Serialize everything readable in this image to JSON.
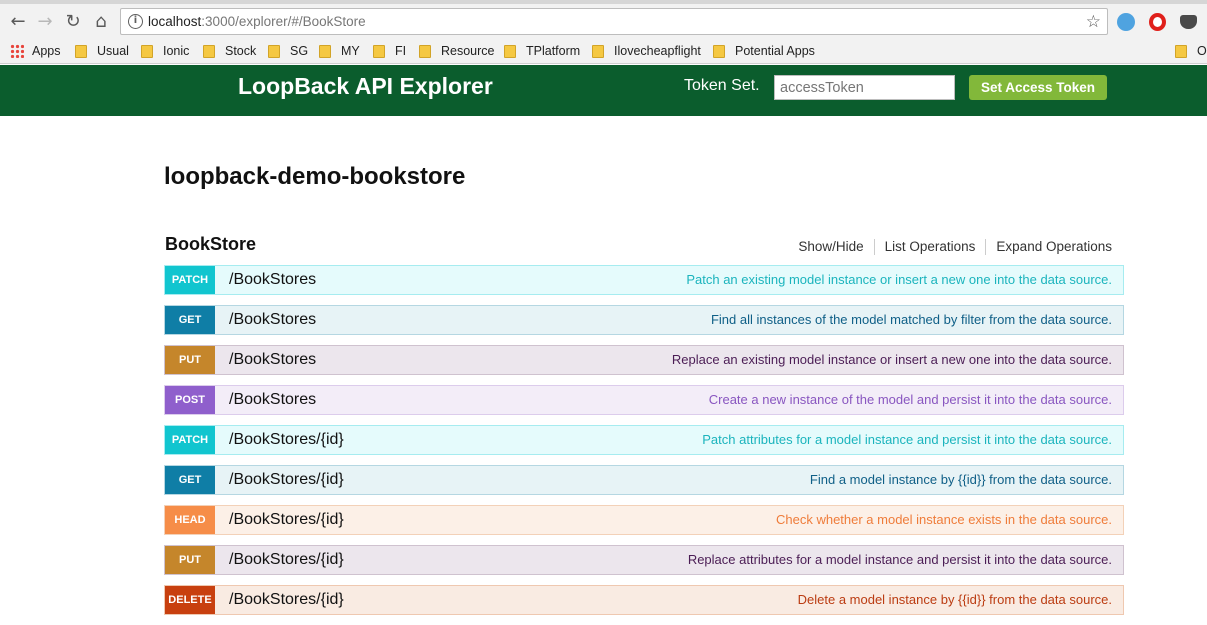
{
  "browser": {
    "url_host": "localhost",
    "url_rest": ":3000/explorer/#/BookStore",
    "bookmarks": [
      "Apps",
      "Usual",
      "Ionic",
      "Stock",
      "SG",
      "MY",
      "FI",
      "Resource",
      "TPlatform",
      "Ilovecheapflight",
      "Potential Apps",
      "O"
    ]
  },
  "header": {
    "title": "LoopBack API Explorer",
    "token_label": "Token Set.",
    "token_placeholder": "accessToken",
    "set_token_label": "Set Access Token"
  },
  "project_title": "loopback-demo-bookstore",
  "resource": {
    "name": "BookStore",
    "links": [
      "Show/Hide",
      "List Operations",
      "Expand Operations"
    ]
  },
  "operations": [
    {
      "method": "PATCH",
      "path": "/BookStores",
      "summary": "Patch an existing model instance or insert a new one into the data source."
    },
    {
      "method": "GET",
      "path": "/BookStores",
      "summary": "Find all instances of the model matched by filter from the data source."
    },
    {
      "method": "PUT",
      "path": "/BookStores",
      "summary": "Replace an existing model instance or insert a new one into the data source."
    },
    {
      "method": "POST",
      "path": "/BookStores",
      "summary": "Create a new instance of the model and persist it into the data source."
    },
    {
      "method": "PATCH",
      "path": "/BookStores/{id}",
      "summary": "Patch attributes for a model instance and persist it into the data source."
    },
    {
      "method": "GET",
      "path": "/BookStores/{id}",
      "summary": "Find a model instance by {{id}} from the data source."
    },
    {
      "method": "HEAD",
      "path": "/BookStores/{id}",
      "summary": "Check whether a model instance exists in the data source."
    },
    {
      "method": "PUT",
      "path": "/BookStores/{id}",
      "summary": "Replace attributes for a model instance and persist it into the data source."
    },
    {
      "method": "DELETE",
      "path": "/BookStores/{id}",
      "summary": "Delete a model instance by {{id}} from the data source."
    }
  ],
  "colors": {
    "header_bg": "#0b5d2d",
    "set_token_button": "#82b83a",
    "patch": "#11c5cf",
    "get": "#0f7ea6",
    "put": "#c5862b",
    "post": "#8f5fcc",
    "head": "#f68d48",
    "delete": "#c8400f"
  }
}
